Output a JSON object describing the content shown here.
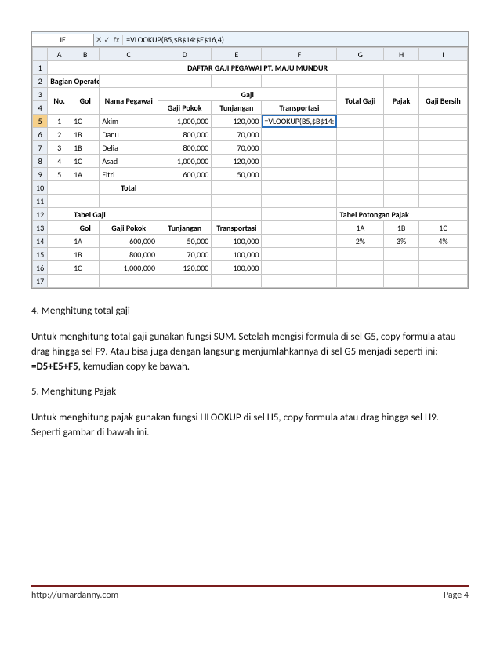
{
  "formula_bar": {
    "name_box": "IF",
    "cancel": "✕",
    "enter": "✓",
    "fx": "fx",
    "formula": "=VLOOKUP(B5,$B$14:$E$16,4)"
  },
  "cols": [
    "A",
    "B",
    "C",
    "D",
    "E",
    "F",
    "G",
    "H",
    "I"
  ],
  "title": "DAFTAR GAJI PEGAWAI PT. MAJU MUNDUR",
  "section_label": "Bagian Operator",
  "header": {
    "no": "No.",
    "gol": "Gol",
    "nama": "Nama Pegawai",
    "gaji": "Gaji",
    "gaji_pokok": "Gaji Pokok",
    "tunjangan": "Tunjangan",
    "transportasi": "Transportasi",
    "total": "Total Gaji",
    "pajak": "Pajak",
    "bersih": "Gaji Bersih"
  },
  "rows": [
    {
      "no": "1",
      "gol": "1C",
      "nama": "Akim",
      "pokok": "1,000,000",
      "tunj": "120,000",
      "trans": "=VLOOKUP(B5,$B$14:$E$16,4)"
    },
    {
      "no": "2",
      "gol": "1B",
      "nama": "Danu",
      "pokok": "800,000",
      "tunj": "70,000",
      "trans": ""
    },
    {
      "no": "3",
      "gol": "1B",
      "nama": "Delia",
      "pokok": "800,000",
      "tunj": "70,000",
      "trans": ""
    },
    {
      "no": "4",
      "gol": "1C",
      "nama": "Asad",
      "pokok": "1,000,000",
      "tunj": "120,000",
      "trans": ""
    },
    {
      "no": "5",
      "gol": "1A",
      "nama": "Fitri",
      "pokok": "600,000",
      "tunj": "50,000",
      "trans": ""
    }
  ],
  "total_label": "Total",
  "tabel_gaji": {
    "title": "Tabel Gaji",
    "h_gol": "Gol",
    "h_pokok": "Gaji Pokok",
    "h_tunj": "Tunjangan",
    "h_trans": "Transportasi",
    "rows": [
      {
        "gol": "1A",
        "pokok": "600,000",
        "tunj": "50,000",
        "trans": "100,000"
      },
      {
        "gol": "1B",
        "pokok": "800,000",
        "tunj": "70,000",
        "trans": "100,000"
      },
      {
        "gol": "1C",
        "pokok": "1,000,000",
        "tunj": "120,000",
        "trans": "100,000"
      }
    ]
  },
  "tabel_pajak": {
    "title": "Tabel Potongan Pajak",
    "h": [
      "1A",
      "1B",
      "1C"
    ],
    "v": [
      "2%",
      "3%",
      "4%"
    ]
  },
  "article": {
    "s4_title": "4. Menghitung total gaji",
    "s4_body": "Untuk menghitung total gaji gunakan fungsi SUM. Setelah mengisi formula di sel G5, copy formula atau drag hingga sel F9. Atau bisa juga dengan langsung menjumlahkannya di sel G5 menjadi seperti ini: ",
    "s4_formula": "=D5+E5+F5",
    "s4_tail": ", kemudian copy ke bawah.",
    "s5_title": "5. Menghitung Pajak",
    "s5_body": "Untuk menghitung pajak gunakan fungsi HLOOKUP di sel H5, copy formula atau drag hingga sel H9. Seperti gambar di bawah ini."
  },
  "footer": {
    "url": "http://umardanny.com",
    "page": "Page 4"
  }
}
